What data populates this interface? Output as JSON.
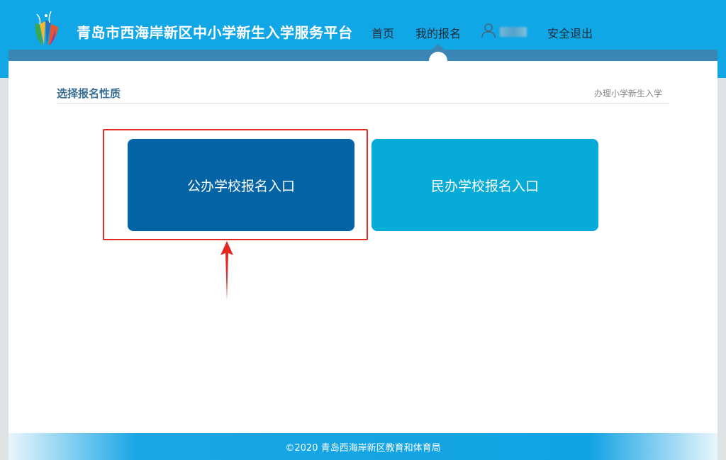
{
  "header": {
    "site_title": "青岛市西海岸新区中小学新生入学服务平台",
    "nav": {
      "home": "首页",
      "my_registration": "我的报名",
      "logout": "安全退出"
    },
    "accent_color": "#11a7e7",
    "strip_color": "#3a86b5"
  },
  "section": {
    "title": "选择报名性质",
    "hint": "办理小学新生入学"
  },
  "options": {
    "public": {
      "label": "公办学校报名入口",
      "color": "#0464a6"
    },
    "private": {
      "label": "民办学校报名入口",
      "color": "#06abd8"
    }
  },
  "annotation": {
    "highlight_color": "#e02a22"
  },
  "footer": {
    "text": "©2020 青岛西海岸新区教育和体育局"
  }
}
